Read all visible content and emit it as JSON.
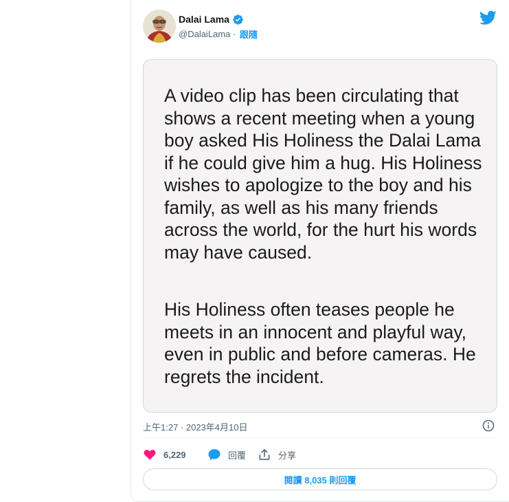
{
  "author": {
    "display_name": "Dalai Lama",
    "handle": "@DalaiLama",
    "separator": " · ",
    "follow_label": "跟隨"
  },
  "media": {
    "paragraph_1": "A video clip has been circulating that shows a recent meeting when a young boy asked His Holiness the Dalai Lama if he could give him a hug. His Holiness wishes to apologize to the boy and his family, as well as his many friends across the world, for the hurt his words may have caused.",
    "paragraph_2": "His Holiness often teases people he meets in an innocent and playful way, even in public and before cameras. He regrets the incident."
  },
  "timestamp": "上午1:27 · 2023年4月10日",
  "actions": {
    "like_count": "6,229",
    "reply_label": "回覆",
    "share_label": "分享"
  },
  "read_replies_label": "閱讀 8,035 則回覆",
  "colors": {
    "accent": "#1d9bf0",
    "like": "#f91880",
    "text_secondary": "#536471"
  },
  "icons": {
    "verified": "verified-badge-icon",
    "twitter": "twitter-bird-icon",
    "info": "info-icon",
    "like": "heart-icon",
    "reply": "speech-bubble-icon",
    "share": "share-upload-icon"
  }
}
